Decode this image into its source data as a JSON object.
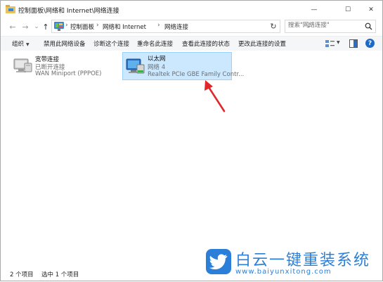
{
  "window": {
    "title": "控制面板\\网络和 Internet\\网络连接",
    "minimize_glyph": "—",
    "maximize_glyph": "☐",
    "close_glyph": "✕"
  },
  "nav": {
    "back_glyph": "←",
    "forward_glyph": "→",
    "recent_glyph": "⌄",
    "up_glyph": "↑",
    "breadcrumb": [
      "控制面板",
      "网络和 Internet",
      "网络连接"
    ],
    "sep_glyph": "›",
    "dropdown_glyph": "⌄",
    "refresh_glyph": "↻",
    "search_placeholder": "搜索\"网络连接\""
  },
  "commandbar": {
    "organize": "组织",
    "dropdown_glyph": "▼",
    "items": [
      "禁用此网络设备",
      "诊断这个连接",
      "重命名此连接",
      "查看此连接的状态",
      "更改此连接的设置"
    ],
    "help": "?"
  },
  "connections": [
    {
      "name": "宽带连接",
      "status": "已断开连接",
      "device": "WAN Miniport (PPPOE)",
      "selected": false
    },
    {
      "name": "以太网",
      "status": "网络 4",
      "device": "Realtek PCIe GBE Family Contr...",
      "selected": true
    }
  ],
  "statusbar": {
    "count": "2 个项目",
    "selected": "选中 1 个项目"
  },
  "watermark": {
    "title": "白云一键重装系统",
    "url": "www.baiyunxitong.com"
  },
  "colors": {
    "selection": "#cce8ff",
    "arrow": "#e0272a",
    "brand": "#2b7fd8"
  }
}
